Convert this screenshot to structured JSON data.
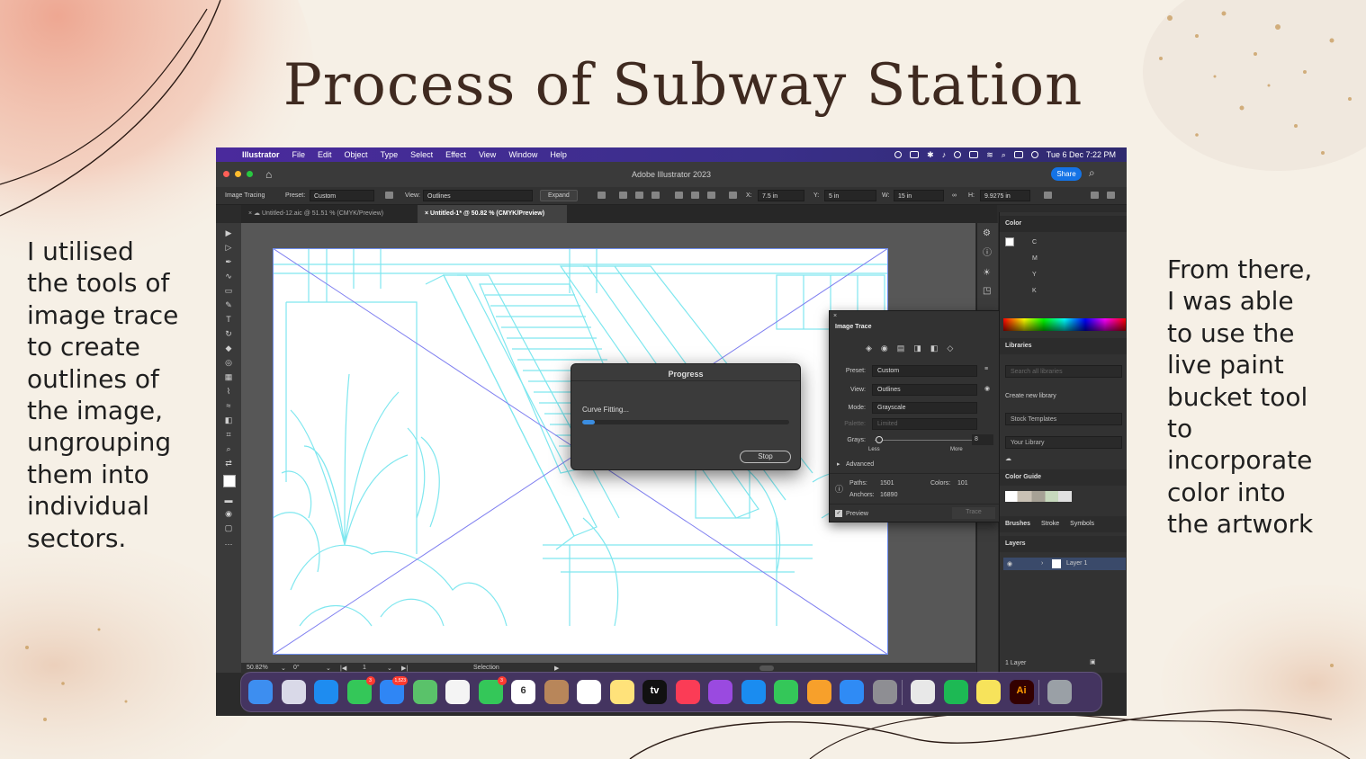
{
  "slide": {
    "title": "Process of Subway Station",
    "left_text": "I utilised\nthe tools of\nimage trace\nto create\noutlines of\nthe image,\nungrouping\nthem into\nindividual\nsectors.",
    "right_text": "From there,\nI was able\nto use the\nlive paint\nbucket tool\nto\nincorporate\ncolor into\nthe artwork"
  },
  "menubar": {
    "app": "Illustrator",
    "items": [
      "File",
      "Edit",
      "Object",
      "Type",
      "Select",
      "Effect",
      "View",
      "Window",
      "Help"
    ],
    "clock": "Tue 6 Dec  7:22 PM"
  },
  "window": {
    "title": "Adobe Illustrator 2023",
    "share": "Share"
  },
  "control_bar": {
    "mode": "Image Tracing",
    "preset_label": "Preset:",
    "preset_value": "Custom",
    "view_label": "View:",
    "view_value": "Outlines",
    "expand": "Expand",
    "x_label": "X:",
    "x_value": "7.5 in",
    "y_label": "Y:",
    "y_value": "5 in",
    "w_label": "W:",
    "w_value": "15 in",
    "h_label": "H:",
    "h_value": "9.9275 in"
  },
  "tabs": [
    {
      "label": "Untitled-12.aic @ 51.51 % (CMYK/Preview)"
    },
    {
      "label": "Untitled-1* @ 50.82 % (CMYK/Preview)"
    }
  ],
  "status_bar": {
    "zoom": "50.82%",
    "rotate": "0°",
    "artboard": "1",
    "tool": "Selection"
  },
  "progress_dialog": {
    "title": "Progress",
    "message": "Curve Fitting...",
    "progress": 0.06,
    "button": "Stop"
  },
  "image_trace": {
    "title": "Image Trace",
    "preset_label": "Preset:",
    "preset_value": "Custom",
    "view_label": "View:",
    "view_value": "Outlines",
    "mode_label": "Mode:",
    "mode_value": "Grayscale",
    "palette_label": "Palette:",
    "palette_value": "Limited",
    "grays_label": "Grays:",
    "grays_value": "8",
    "less": "Less",
    "more": "More",
    "advanced": "Advanced",
    "paths_label": "Paths:",
    "paths_value": "1501",
    "colors_label": "Colors:",
    "colors_value": "101",
    "anchors_label": "Anchors:",
    "anchors_value": "16890",
    "preview": "Preview",
    "trace": "Trace"
  },
  "right_panel": {
    "color": "Color",
    "cmyk": [
      "C",
      "M",
      "Y",
      "K"
    ],
    "libraries": "Libraries",
    "search_placeholder": "Search all libraries",
    "create_library": "Create new library",
    "stock_templates": "Stock Templates",
    "your_library": "Your Library",
    "color_guide": "Color Guide",
    "brushes": "Brushes",
    "stroke": "Stroke",
    "symbols": "Symbols",
    "layers": "Layers",
    "layer_name": "Layer 1",
    "layer_count": "1 Layer"
  },
  "dock": {
    "apps": [
      {
        "name": "Finder",
        "color": "#3d8ef0"
      },
      {
        "name": "Launchpad",
        "color": "#d9d9e8"
      },
      {
        "name": "Safari",
        "color": "#1e8cf0"
      },
      {
        "name": "Messages",
        "color": "#34c759",
        "badge": "3"
      },
      {
        "name": "Mail",
        "color": "#2f86f5",
        "badge": "1,523"
      },
      {
        "name": "Maps",
        "color": "#5ac26a"
      },
      {
        "name": "Photos",
        "color": "#f4f4f4"
      },
      {
        "name": "FaceTime",
        "color": "#34c759",
        "badge": "3"
      },
      {
        "name": "Calendar",
        "color": "#ffffff",
        "text": "6"
      },
      {
        "name": "Contacts",
        "color": "#b8865a"
      },
      {
        "name": "Reminders",
        "color": "#ffffff"
      },
      {
        "name": "Notes",
        "color": "#ffe27a"
      },
      {
        "name": "TV",
        "color": "#111111",
        "text": "tv"
      },
      {
        "name": "Music",
        "color": "#fb3c56"
      },
      {
        "name": "Podcasts",
        "color": "#9a4ae0"
      },
      {
        "name": "Keynote",
        "color": "#1a8cf0"
      },
      {
        "name": "Numbers",
        "color": "#34c759"
      },
      {
        "name": "Pages",
        "color": "#f7a02b"
      },
      {
        "name": "App Store",
        "color": "#2f8bf5"
      },
      {
        "name": "System Settings",
        "color": "#8e8e93"
      },
      {
        "name": "Chrome",
        "color": "#e8e8e8"
      },
      {
        "name": "Spotify",
        "color": "#1db954"
      },
      {
        "name": "Stickies",
        "color": "#f7e35b"
      },
      {
        "name": "Illustrator",
        "color": "#330000",
        "text": "Ai"
      },
      {
        "name": "Trash",
        "color": "#9aa0a6"
      }
    ]
  },
  "colors": {
    "outline": "#7fe7ef",
    "accent": "#1473e6",
    "title": "#3f2a20"
  }
}
